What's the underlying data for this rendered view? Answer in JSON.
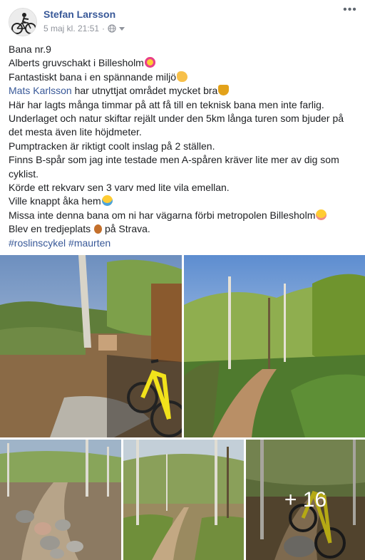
{
  "post": {
    "author": "Stefan Larsson",
    "timestamp": "5 maj kl. 21:51",
    "separator": "·",
    "privacy_icon": "globe-icon",
    "menu_icon": "more-options-icon",
    "menu_glyph": "•••",
    "lines": {
      "l1": "Bana nr.9",
      "l2": "Alberts gruvschakt i Billesholm",
      "l3": "Fantastiskt bana i en spännande miljö",
      "l4_mention": "Mats Karlsson",
      "l4_rest": " har utnyttjat området mycket bra",
      "l5": "Här har lagts många timmar på att få till en teknisk bana men inte farlig.",
      "l6": "Underlaget och natur skiftar rejält under den 5km långa turen som bjuder på",
      "l7": "det mesta även lite höjdmeter.",
      "l8": "Pumptracken är riktigt coolt inslag på 2 ställen.",
      "l9": "Finns B-spår som jag inte testade men A-spåren kräver lite mer av dig som",
      "l10": "cyklist.",
      "l11": "Körde ett rekvarv sen 3 varv med lite vila emellan.",
      "l12": "Ville knappt åka hem",
      "l13": "Missa inte denna bana om ni har vägarna förbi metropolen Billesholm",
      "l14_pre": "Blev en tredjeplats ",
      "l14_post": " på Strava.",
      "hashtag1": "#roslinscykel",
      "hashtag2": "#maurten"
    },
    "emojis": {
      "star_struck": "star-struck-emoji",
      "clap": "clapping-hands-emoji",
      "trophy": "trophy-emoji",
      "joy": "tears-of-joy-emoji",
      "relieved": "smiling-face-emoji",
      "bronze": "bronze-medal-emoji"
    },
    "photos": {
      "more_count": "+ 16"
    },
    "colors": {
      "link": "#385898",
      "meta": "#90949c",
      "bike": "#f2e21b"
    }
  }
}
